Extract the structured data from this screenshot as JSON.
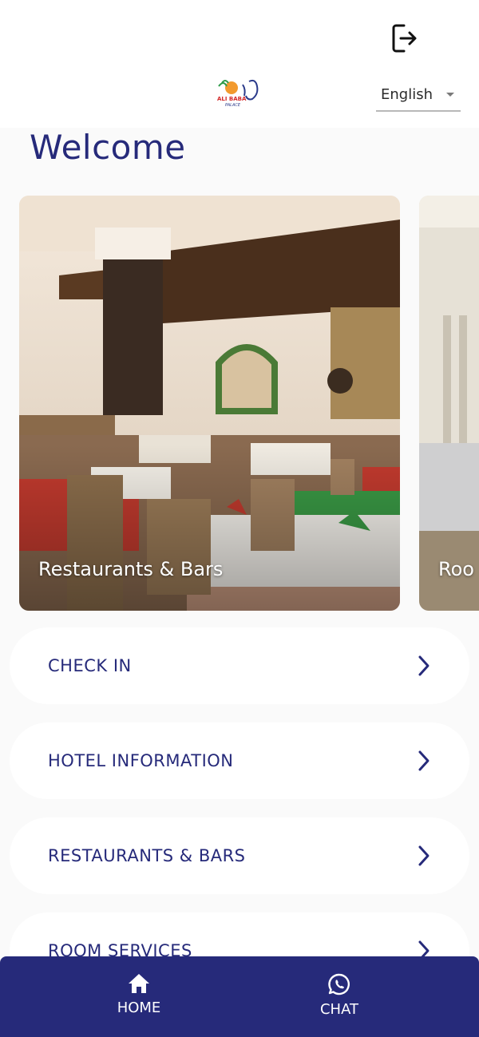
{
  "header": {
    "logout_icon": "logout-icon",
    "logo_text": "ALI BABA PALACE",
    "language": {
      "selected": "English"
    }
  },
  "main": {
    "welcome": "Welcome",
    "carousel": [
      {
        "title": "Restaurants & Bars",
        "image": "restaurant-photo"
      },
      {
        "title": "Roo",
        "image": "room-photo"
      }
    ],
    "menu": [
      {
        "label": "CHECK IN",
        "icon": "chevron-right-icon"
      },
      {
        "label": "HOTEL INFORMATION",
        "icon": "chevron-right-icon"
      },
      {
        "label": "RESTAURANTS & BARS",
        "icon": "chevron-right-icon"
      },
      {
        "label": "ROOM SERVICES",
        "icon": "chevron-right-icon"
      }
    ]
  },
  "bottom_nav": {
    "items": [
      {
        "label": "HOME",
        "icon": "home-icon"
      },
      {
        "label": "CHAT",
        "icon": "whatsapp-icon"
      }
    ]
  },
  "colors": {
    "primary": "#262a7a",
    "background": "#fafafa",
    "card": "#ffffff"
  }
}
